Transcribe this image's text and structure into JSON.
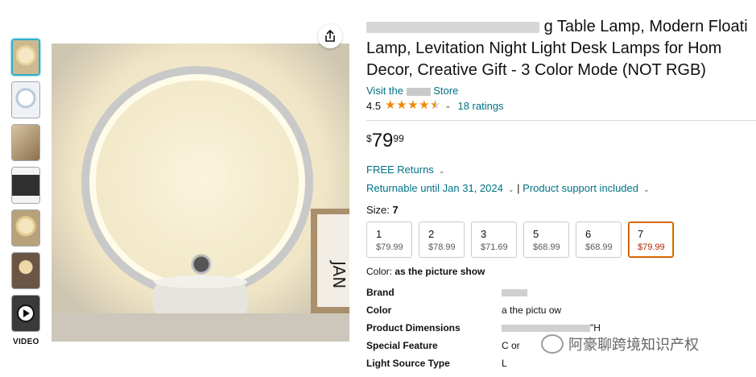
{
  "thumbnails": [
    {
      "name": "lamp-warm-front",
      "bg": "#d9c9a8"
    },
    {
      "name": "lamp-white",
      "bg": "#e8eef5"
    },
    {
      "name": "lamp-sideboard",
      "bg": "#b39a7a"
    },
    {
      "name": "lamp-parts",
      "bg": "#3a3a3a"
    },
    {
      "name": "lamp-warm-2",
      "bg": "#c9b58e"
    },
    {
      "name": "lamp-dark",
      "bg": "#5a4a3c"
    },
    {
      "name": "video",
      "bg": "#2a2a2a"
    }
  ],
  "video_label": "VIDEO",
  "product": {
    "title_line1": "g Table Lamp, Modern Floati",
    "title_line2": "Lamp, Levitation Night Light Desk Lamps for Hom",
    "title_line3": "Decor, Creative Gift - 3 Color Mode (NOT RGB)",
    "store_prefix": "Visit the ",
    "store_suffix": " Store",
    "rating_value": "4.5",
    "ratings_count": "18 ratings",
    "price_symbol": "$",
    "price_whole": "79",
    "price_fraction": "99",
    "free_returns": "FREE Returns",
    "returnable": "Returnable until Jan 31, 2024",
    "separator": "|",
    "support": "Product support included"
  },
  "size": {
    "label": "Size: ",
    "selected": "7",
    "options": [
      {
        "name": "1",
        "price": "$79.99"
      },
      {
        "name": "2",
        "price": "$78.99"
      },
      {
        "name": "3",
        "price": "$71.69"
      },
      {
        "name": "5",
        "price": "$68.99"
      },
      {
        "name": "6",
        "price": "$68.99"
      },
      {
        "name": "7",
        "price": "$79.99"
      }
    ]
  },
  "color": {
    "label": "Color: ",
    "value": "as the picture show"
  },
  "specs": [
    {
      "key": "Brand",
      "value": ""
    },
    {
      "key": "Color",
      "value": "a the pictu ow"
    },
    {
      "key": "Product Dimensions",
      "value": "\"H"
    },
    {
      "key": "Special Feature",
      "value": "C or"
    },
    {
      "key": "Light Source Type",
      "value": "L"
    }
  ],
  "watermark": "阿豪聊跨境知识产权",
  "colors": {
    "link": "#007185",
    "star": "#f08804",
    "selected_border": "#c45500",
    "selected_price": "#b12704",
    "thumb_active": "#2fb0c9"
  }
}
